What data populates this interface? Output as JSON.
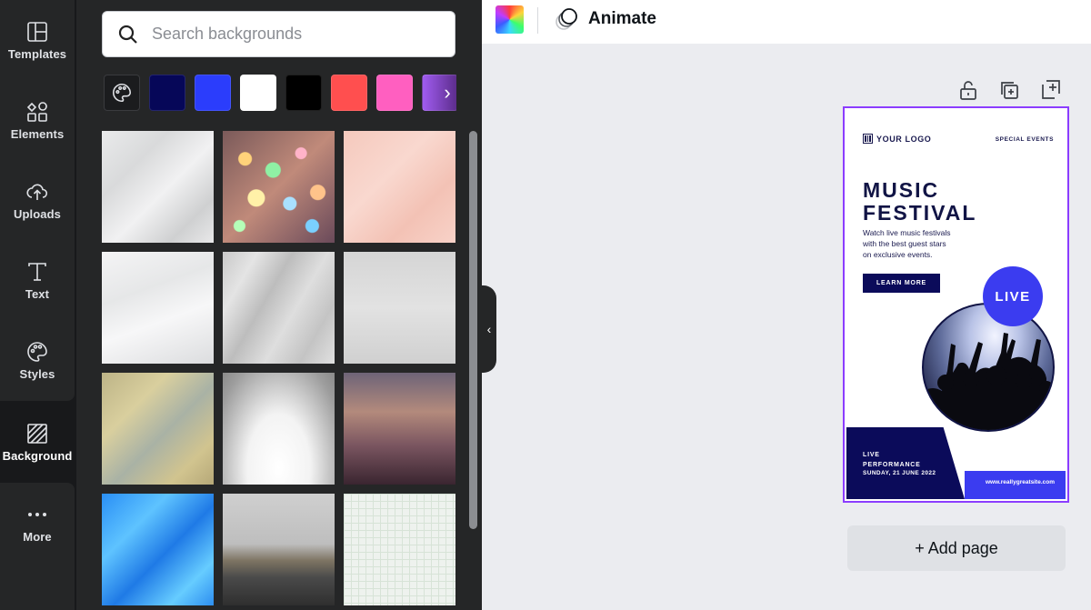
{
  "rail": {
    "items": [
      {
        "label": "Templates",
        "icon": "templates-icon"
      },
      {
        "label": "Elements",
        "icon": "elements-icon"
      },
      {
        "label": "Uploads",
        "icon": "uploads-icon"
      },
      {
        "label": "Text",
        "icon": "text-icon"
      },
      {
        "label": "Styles",
        "icon": "styles-icon"
      },
      {
        "label": "Background",
        "icon": "background-icon",
        "active": true
      },
      {
        "label": "More",
        "icon": "more-icon"
      }
    ]
  },
  "panel": {
    "search_placeholder": "Search backgrounds",
    "swatch_colors": [
      "#060758",
      "#2b3dfc",
      "#ffffff",
      "#000000",
      "#ff4f4f",
      "#ff5fc0"
    ],
    "swatch_gradient": "linear-gradient(90deg, #a05cf0, #5b2c8a)"
  },
  "topbar": {
    "animate_label": "Animate"
  },
  "poster": {
    "logo": "YOUR LOGO",
    "special": "SPECIAL EVENTS",
    "title_line1": "MUSIC",
    "title_line2": "FESTIVAL",
    "desc_line1": "Watch live music festivals",
    "desc_line2": "with the best guest stars",
    "desc_line3": "on exclusive events.",
    "button": "LEARN MORE",
    "live": "LIVE",
    "perf_line1": "LIVE",
    "perf_line2": "PERFORMANCE",
    "date": "SUNDAY, 21 JUNE 2022",
    "site": "www.reallygreatsite.com"
  },
  "add_page_label": "+ Add page",
  "colors": {
    "accent": "#8b3dff",
    "navy": "#0b0b5a",
    "blue": "#3b3cf0"
  }
}
